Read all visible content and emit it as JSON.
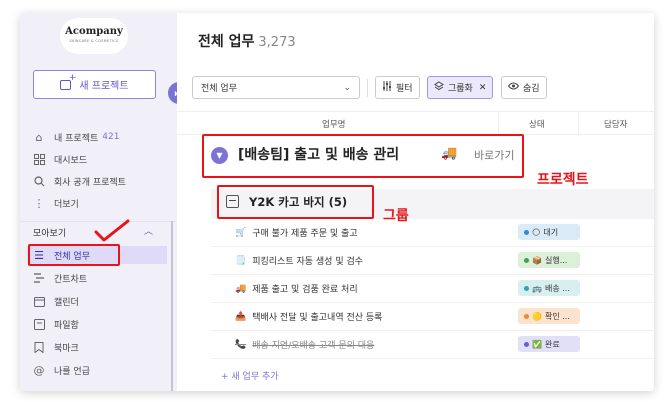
{
  "sidebar": {
    "logo_main": "Acompany",
    "logo_sub": "SKINCARE & COSMETICS",
    "new_project": "새 프로젝트",
    "items": [
      {
        "label": "내 프로젝트",
        "count": "421"
      },
      {
        "label": "대시보드"
      },
      {
        "label": "회사 공개 프로젝트"
      },
      {
        "label": "더보기"
      }
    ],
    "section": "모아보기",
    "views": [
      {
        "label": "전체 업무"
      },
      {
        "label": "간트차트"
      },
      {
        "label": "캘린더"
      },
      {
        "label": "파일함"
      },
      {
        "label": "북마크"
      },
      {
        "label": "나를 언급"
      }
    ]
  },
  "header": {
    "title": "전체 업무",
    "count": "3,273"
  },
  "toolbar": {
    "view_value": "전체 업무",
    "filter": "필터",
    "group": "그룹화",
    "hide": "숨김"
  },
  "table": {
    "columns": [
      "업무명",
      "상태",
      "담당자"
    ]
  },
  "project": {
    "title": "[배송팀] 출고 및 배송 관리",
    "emoji": "🚚",
    "link": "바로가기",
    "annotation": "프로젝트"
  },
  "group": {
    "title": "Y2K 카고 바지 (5)",
    "annotation": "그룹"
  },
  "tasks": [
    {
      "emoji": "🛒",
      "name": "구매 불가 제품 주문 및 출고",
      "status": "대기",
      "status_emoji": "🌕",
      "bg": "#dbeaf7",
      "dot": "#2c8cd6"
    },
    {
      "emoji": "🗒️",
      "name": "피킹리스트 자동 생성 및 검수",
      "status": "실행...",
      "status_emoji": "📦",
      "bg": "#dcefd9",
      "dot": "#3ea44a"
    },
    {
      "emoji": "🚚",
      "name": "제품 출고 및 검품 완료 처리",
      "status": "배송 ...",
      "status_emoji": "🚌",
      "bg": "#d8eff0",
      "dot": "#2aa6a6"
    },
    {
      "emoji": "📤",
      "name": "택배사 전달 및 출고내역 전산 등록",
      "status": "확인 ...",
      "status_emoji": "🟡",
      "bg": "#fbe3cf",
      "dot": "#ee8a2c"
    },
    {
      "emoji": "📞",
      "name": "배송 지연/오배송 고객 문의 대응",
      "status": "완료",
      "status_emoji": "✅",
      "bg": "#e2e0f8",
      "dot": "#6a5fd0",
      "done": true
    }
  ],
  "add_task": "+ 새 업무 추가"
}
